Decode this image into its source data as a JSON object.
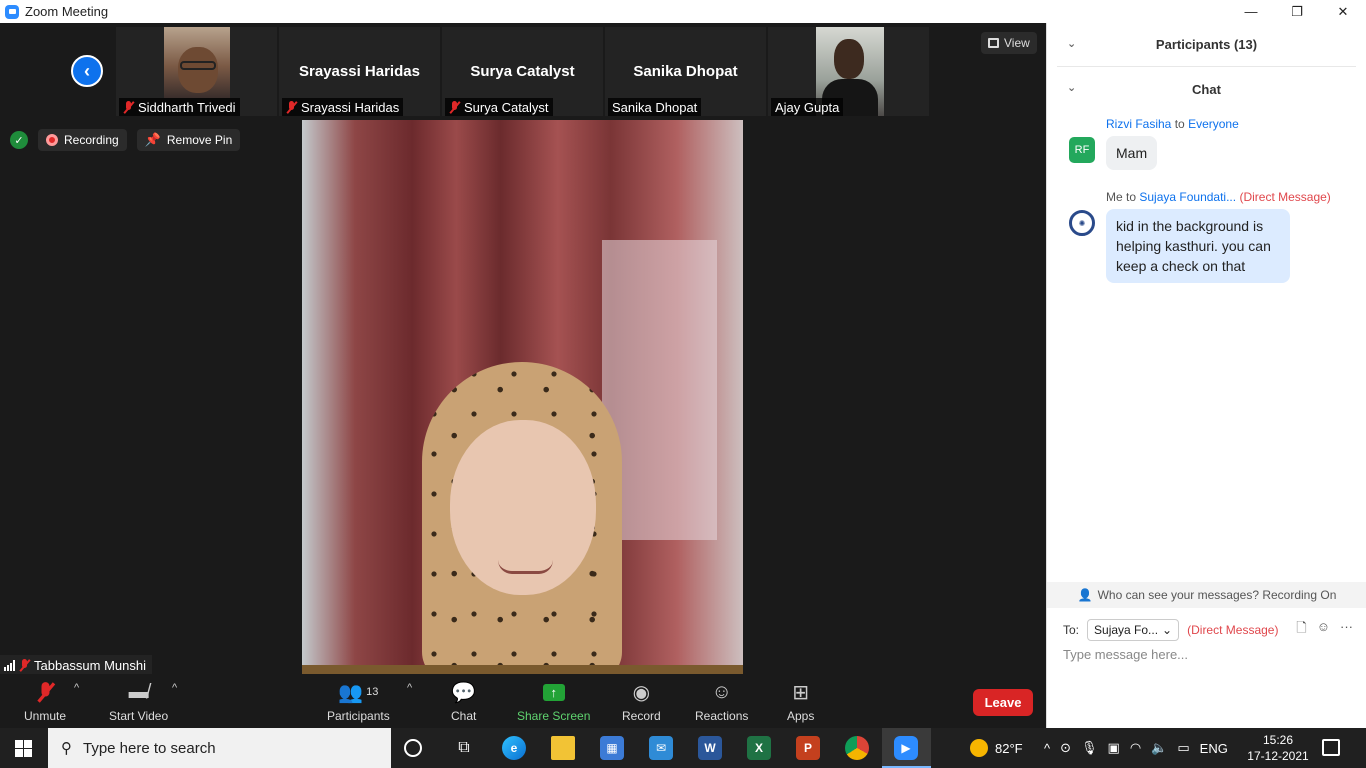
{
  "window": {
    "title": "Zoom Meeting",
    "controls": {
      "minimize": "—",
      "restore": "❐",
      "close": "✕"
    }
  },
  "view_button": {
    "label": "View"
  },
  "participants_strip": [
    {
      "name": "Siddharth Trivedi",
      "muted": true,
      "video": true
    },
    {
      "name": "Srayassi Haridas",
      "muted": true,
      "video": false,
      "display_name": "Srayassi Haridas"
    },
    {
      "name": "Surya Catalyst",
      "muted": true,
      "video": false,
      "display_name": "Surya Catalyst"
    },
    {
      "name": "Sanika Dhopat",
      "muted": false,
      "video": false,
      "display_name": "Sanika Dhopat"
    },
    {
      "name": "Ajay Gupta",
      "muted": false,
      "video": true
    }
  ],
  "status": {
    "recording_label": "Recording",
    "remove_pin_label": "Remove Pin"
  },
  "pinned_speaker": {
    "name": "Tabbassum Munshi",
    "muted": true
  },
  "toolbar": {
    "unmute": "Unmute",
    "start_video": "Start Video",
    "participants": "Participants",
    "participant_count": "13",
    "chat": "Chat",
    "share_screen": "Share Screen",
    "record": "Record",
    "reactions": "Reactions",
    "apps": "Apps",
    "leave": "Leave"
  },
  "panel": {
    "participants_header": "Participants (13)",
    "chat_header": "Chat",
    "messages": [
      {
        "avatar": "RF",
        "from": "Rizvi Fasiha",
        "to_word": "to",
        "to": "Everyone",
        "text": "Mam"
      },
      {
        "avatar": "logo",
        "from": "Me",
        "to_word": "to",
        "to": "Sujaya Foundati...",
        "tag": "(Direct Message)",
        "text": "kid in the background is helping kasthuri. you can keep a check on that"
      }
    ],
    "who_can_see": "Who can see your messages? Recording On",
    "to_label": "To:",
    "to_selected": "Sujaya Fo...",
    "to_tag": "(Direct Message)",
    "input_placeholder": "Type message here..."
  },
  "taskbar": {
    "search_placeholder": "Type here to search",
    "weather": "82°F",
    "language": "ENG",
    "time": "15:26",
    "date": "17-12-2021"
  },
  "colors": {
    "accent": "#0e72ed",
    "leave": "#d92525",
    "share": "#22a336",
    "muted": "#e02828"
  }
}
